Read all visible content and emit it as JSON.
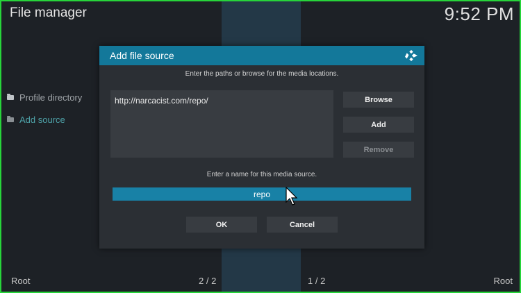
{
  "app": {
    "title": "File manager",
    "clock": "9:52 PM"
  },
  "sidebar": {
    "items": [
      {
        "label": "Profile directory",
        "icon": "folder-icon",
        "active": false
      },
      {
        "label": "Add source",
        "icon": "folder-icon",
        "active": true
      }
    ]
  },
  "footer": {
    "left_root": "Root",
    "left_page": "2 / 2",
    "right_page": "1 / 2",
    "right_root": "Root"
  },
  "dialog": {
    "title": "Add file source",
    "logo_icon": "kodi-logo-icon",
    "paths_instruction": "Enter the paths or browse for the media locations.",
    "path_value": "http://narcacist.com/repo/",
    "browse_label": "Browse",
    "add_label": "Add",
    "remove_label": "Remove",
    "name_instruction": "Enter a name for this media source.",
    "name_value": "repo",
    "ok_label": "OK",
    "cancel_label": "Cancel"
  },
  "colors": {
    "accent": "#13789a",
    "highlight_field": "#1881a6",
    "active_item": "#4ea3a9",
    "frame_border": "#27d43a"
  }
}
